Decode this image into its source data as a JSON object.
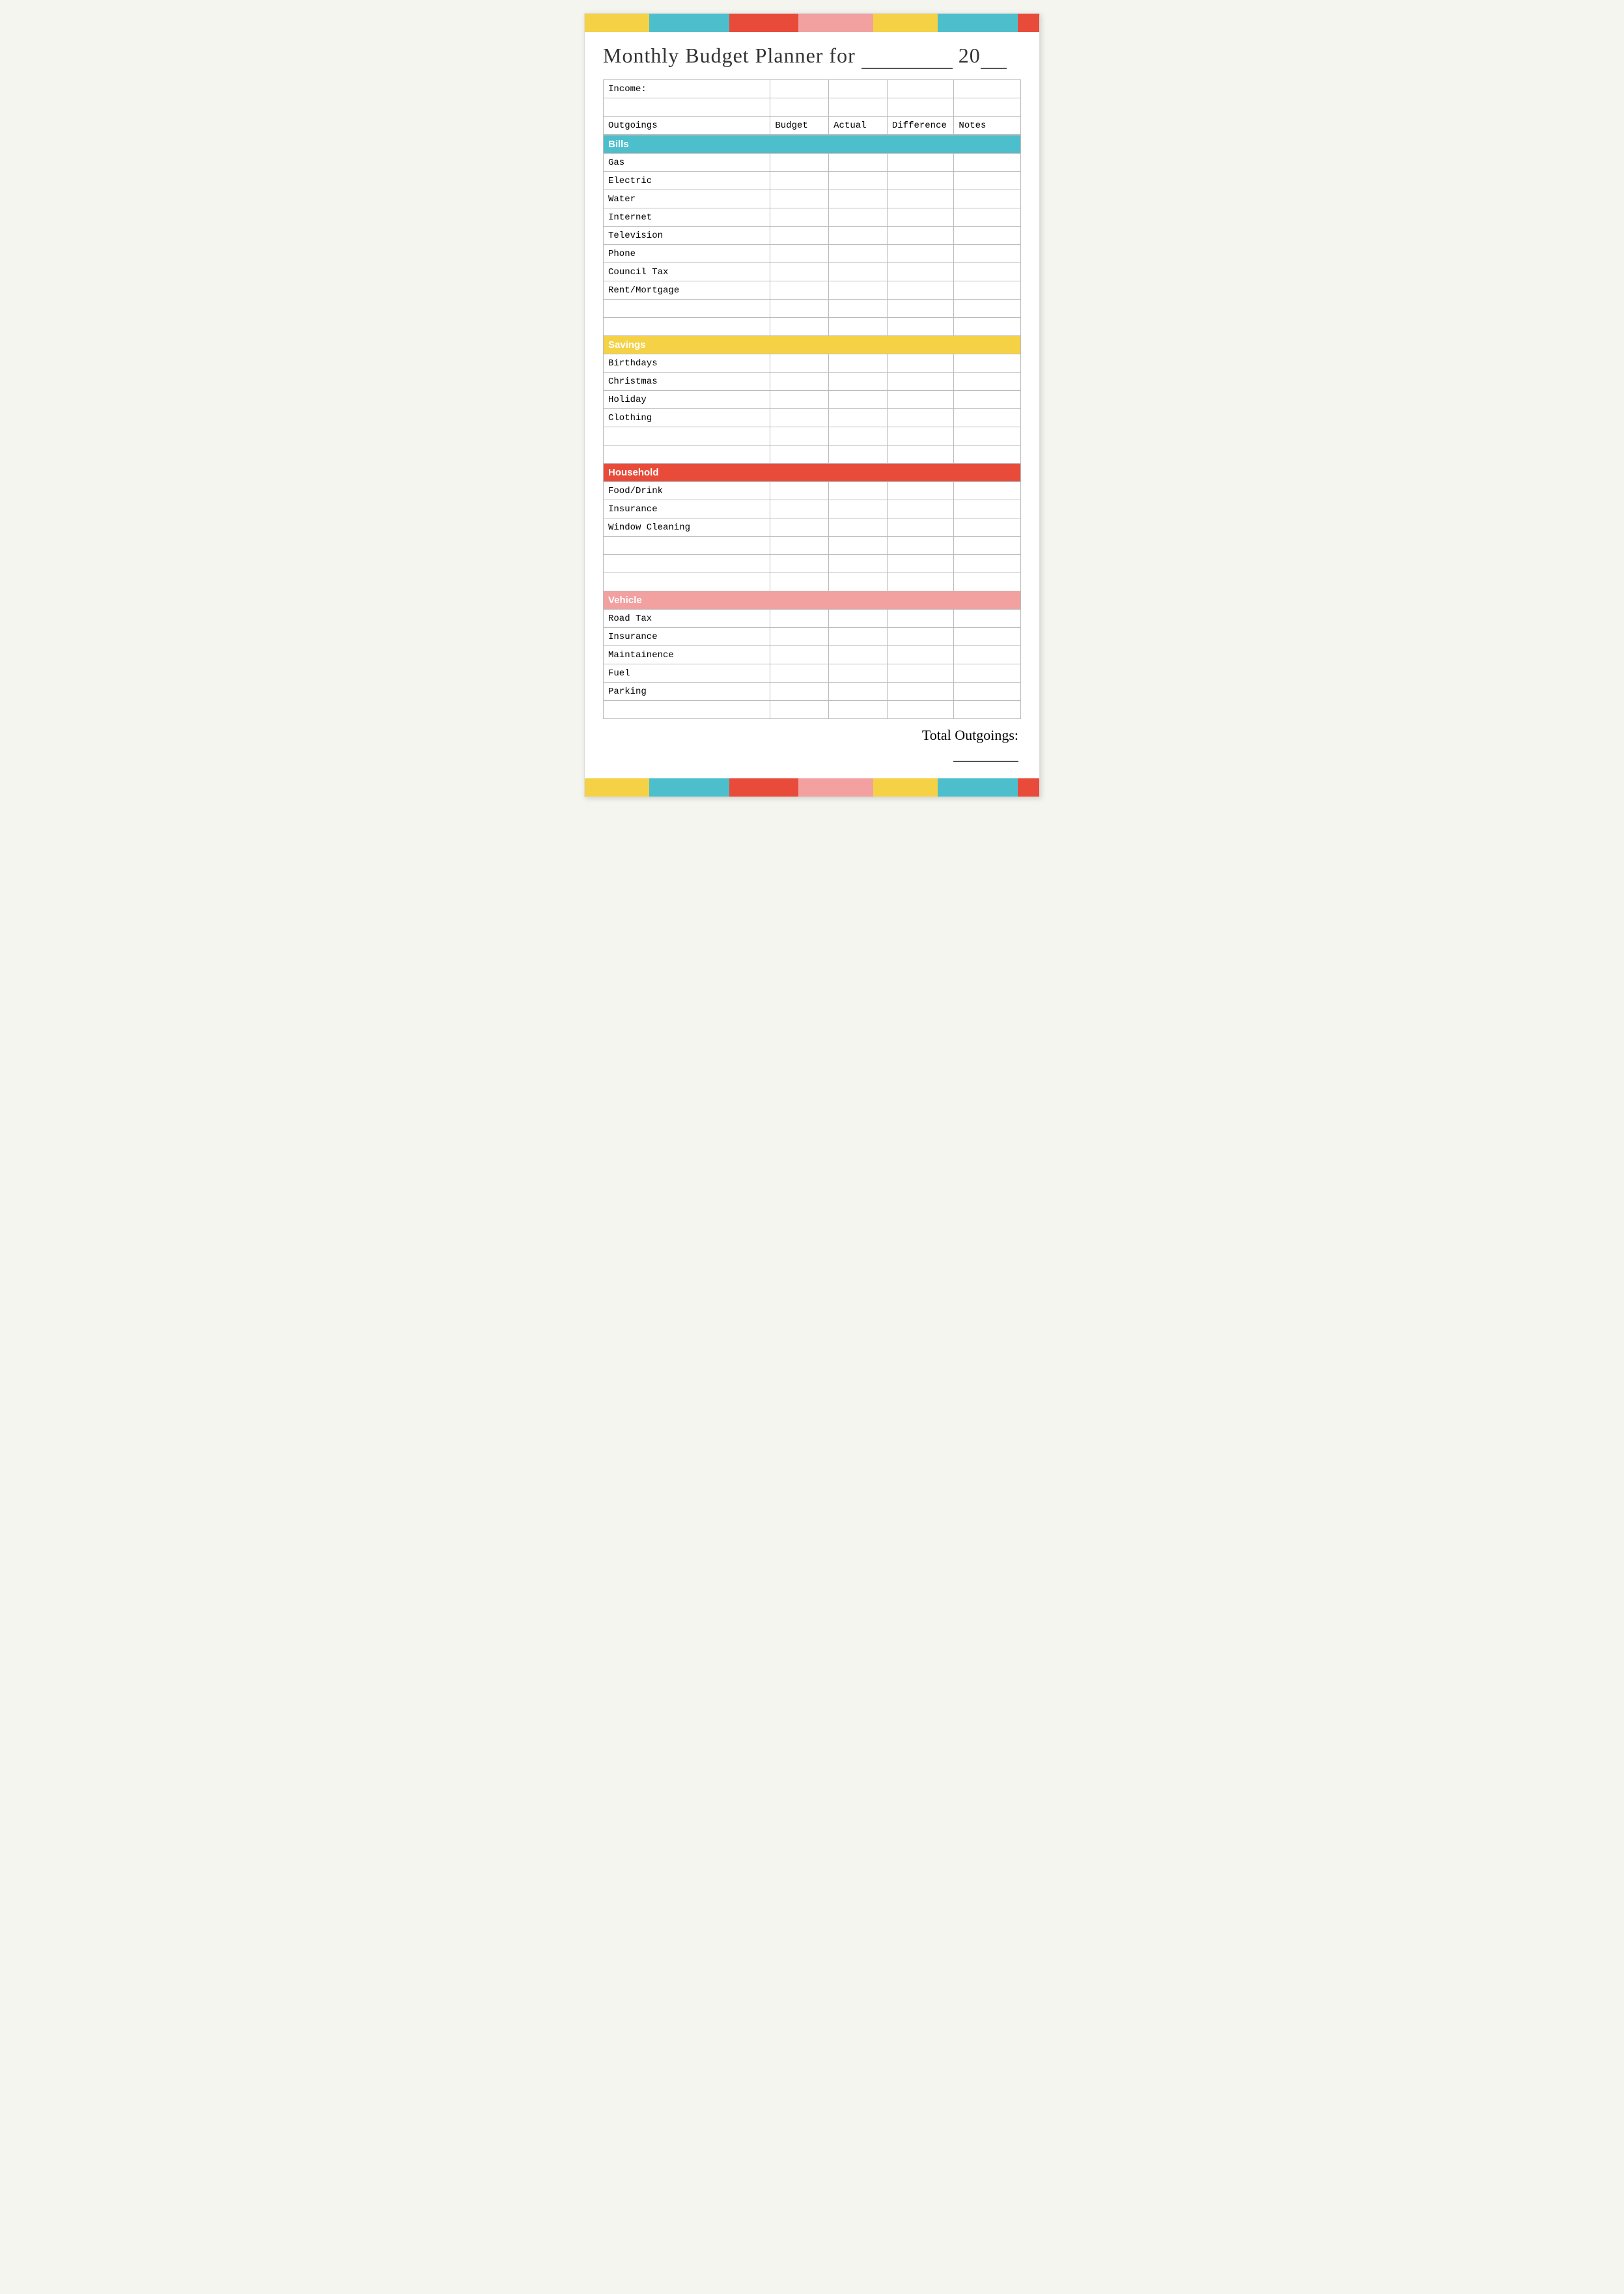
{
  "colorBar": {
    "segments": [
      "yellow",
      "teal",
      "red",
      "pink",
      "yellow",
      "teal",
      "red"
    ]
  },
  "title": {
    "text": "Monthly Budget Planner for",
    "yearPrefix": "20",
    "yearSuffix": "__"
  },
  "table": {
    "incomeLabel": "Income:",
    "columns": {
      "outgoings": "Outgoings",
      "budget": "Budget",
      "actual": "Actual",
      "difference": "Difference",
      "notes": "Notes"
    },
    "categories": [
      {
        "name": "Bills",
        "colorClass": "cat-bills",
        "items": [
          "Gas",
          "Electric",
          "Water",
          "Internet",
          "Television",
          "Phone",
          "Council Tax",
          "Rent/Mortgage",
          "",
          ""
        ]
      },
      {
        "name": "Savings",
        "colorClass": "cat-savings",
        "items": [
          "Birthdays",
          "Christmas",
          "Holiday",
          "Clothing",
          "",
          ""
        ]
      },
      {
        "name": "Household",
        "colorClass": "cat-household",
        "items": [
          "Food/Drink",
          "Insurance",
          "Window Cleaning",
          "",
          "",
          ""
        ]
      },
      {
        "name": "Vehicle",
        "colorClass": "cat-vehicle",
        "items": [
          "Road Tax",
          "Insurance",
          "Maintainence",
          "Fuel",
          "Parking",
          ""
        ]
      }
    ],
    "totalLabel": "Total Outgoings:",
    "totalValue": "_____"
  }
}
